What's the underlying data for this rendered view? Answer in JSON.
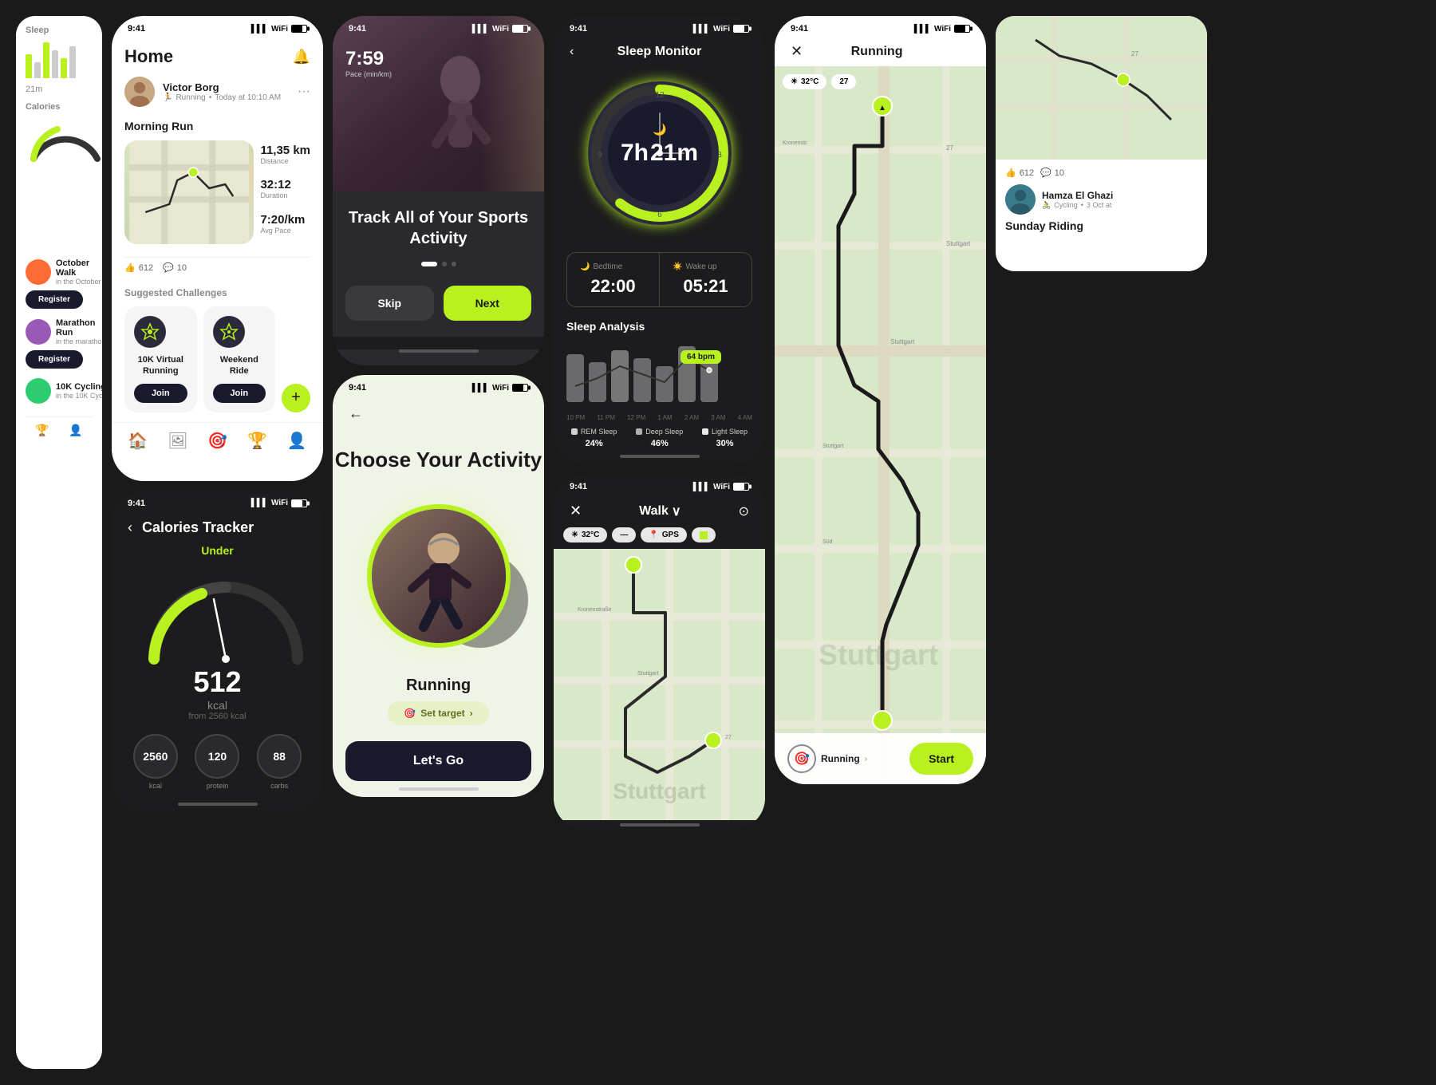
{
  "app": {
    "accent_color": "#b8f020",
    "dark_bg": "#1c1c1e",
    "light_bg": "#ffffff"
  },
  "left_partial": {
    "sleep_label": "Sleep",
    "calories_label": "Calories",
    "meter_value": "21m"
  },
  "home_screen": {
    "status_time": "9:41",
    "title": "Home",
    "user_name": "Victor Borg",
    "user_activity": "Running",
    "user_time": "Today at 10:10 AM",
    "section_title": "Morning Run",
    "distance_value": "11,35 km",
    "distance_label": "Distance",
    "duration_value": "32:12",
    "duration_label": "Duration",
    "pace_value": "7:20/km",
    "pace_label": "Avg Pace",
    "likes": "612",
    "comments": "10",
    "suggested_title": "Suggested Challenges",
    "challenge1_name": "10K Virtual Running",
    "challenge2_name": "Weekend Ride",
    "join_label": "Join"
  },
  "onboarding_screen": {
    "status_time": "9:41",
    "pace_value": "7:59",
    "pace_label": "Pace (min/km)",
    "headline": "Track All of Your Sports Activity",
    "skip_label": "Skip",
    "next_label": "Next",
    "dots": [
      true,
      false,
      false
    ]
  },
  "activity_screen": {
    "status_time": "9:41",
    "title": "Choose Your Activity",
    "activity_name": "Running",
    "set_target_label": "Set target",
    "lets_go_label": "Let's Go"
  },
  "sleep_screen": {
    "status_time": "9:41",
    "title": "Sleep Monitor",
    "hours": "7h",
    "minutes": "21m",
    "bedtime_label": "Bedtime",
    "bedtime_value": "22:00",
    "wakeup_label": "Wake up",
    "wakeup_value": "05:21",
    "analysis_title": "Sleep Analysis",
    "bpm_badge": "64 bpm",
    "rem_label": "REM Sleep",
    "rem_pct": "24%",
    "deep_label": "Deep Sleep",
    "deep_pct": "46%",
    "light_label": "Light Sleep",
    "light_pct": "30%",
    "x_labels": [
      "10 PM",
      "11 PM",
      "12 PM",
      "1 AM",
      "2 AM",
      "3 AM",
      "4 AM"
    ]
  },
  "calories_screen": {
    "status_time": "9:41",
    "title": "Calories Tracker",
    "status": "Under",
    "calories_value": "512",
    "calories_unit": "kcal",
    "calories_from": "from 2560 kcal",
    "metric1_value": "2560",
    "metric2_value": "120",
    "metric3_value": "88"
  },
  "walk_screen": {
    "status_time": "9:41",
    "title": "Walk",
    "temp": "32°C",
    "gps_label": "GPS",
    "city_label": "Stuttgart"
  },
  "route_screen": {
    "status_time": "9:41",
    "title": "Running",
    "temp": "32°C",
    "city_label": "Stuttgart",
    "activity_label": "Running",
    "start_label": "Start"
  },
  "right_partial": {
    "likes": "612",
    "comments": "10",
    "user_name": "Hamza El Ghazi",
    "user_activity": "Cycling",
    "user_date": "3 Oct at",
    "activity_title": "Sunday Riding"
  }
}
